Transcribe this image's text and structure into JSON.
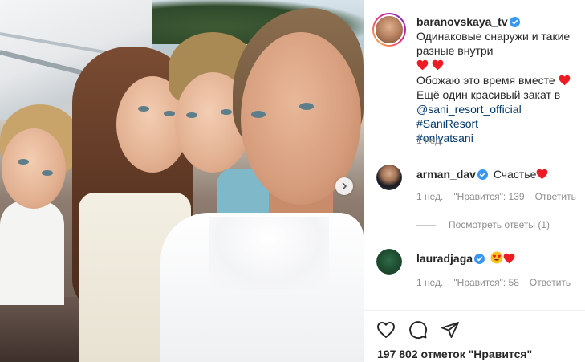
{
  "post": {
    "author": "baranovskaya_tv",
    "caption_line1": "Одинаковые снаружи и такие разные внутри",
    "caption_line2": "Обожаю это время вместе",
    "caption_line3": "Ещё один красивый закат в",
    "mention": "@sani_resort_official",
    "hashtag1": "#SaniResort",
    "hashtag2": "#onlyatsani",
    "time": "1 нед."
  },
  "comments": [
    {
      "user": "arman_dav",
      "text": "Счастье",
      "time": "1 нед.",
      "likes": "\"Нравится\": 139",
      "reply": "Ответить",
      "view_replies": "Посмотреть ответы (1)"
    },
    {
      "user": "lauradjaga",
      "time": "1 нед.",
      "likes": "\"Нравится\": 58",
      "reply": "Ответить"
    }
  ],
  "footer": {
    "likes_text": "197 802 отметок \"Нравится\""
  },
  "icons": {
    "verified": "verified-badge-icon",
    "heart": "red-heart-icon",
    "like": "heart-outline-icon",
    "comment": "comment-bubble-icon",
    "share": "paper-plane-icon",
    "next": "chevron-right-icon"
  },
  "colors": {
    "verified": "#3897f0",
    "heart": "#ed1c24",
    "link": "#00376b",
    "meta": "#8e8e8e"
  }
}
